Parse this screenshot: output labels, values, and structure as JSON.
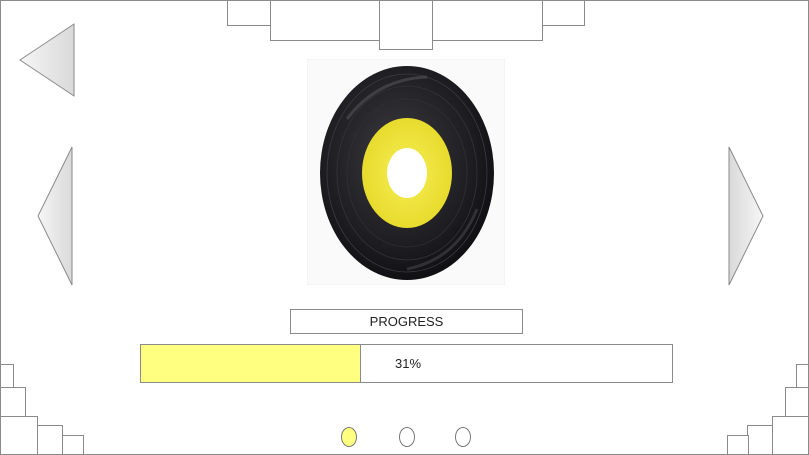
{
  "progress": {
    "label": "PROGRESS",
    "value_text": "31%",
    "fill_fraction": 0.415
  },
  "icons": {
    "back": "back-triangle-icon",
    "previous": "previous-triangle-icon",
    "next": "next-triangle-icon",
    "album": "vinyl-record-icon"
  },
  "pagination": {
    "count": 3,
    "active_index": 0
  },
  "colors": {
    "accent": "#ffff80",
    "record_label": "#f2e83a",
    "record_disc": "#1e1e22",
    "outline": "#8a8a8a"
  }
}
